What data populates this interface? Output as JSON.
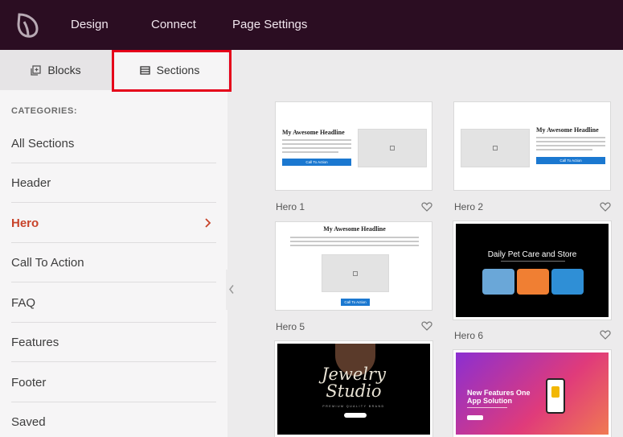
{
  "topbar": {
    "nav": [
      "Design",
      "Connect",
      "Page Settings"
    ]
  },
  "tabs": {
    "blocks": "Blocks",
    "sections": "Sections"
  },
  "sidebar": {
    "categories_title": "CATEGORIES:",
    "categories": [
      "All Sections",
      "Header",
      "Hero",
      "Call To Action",
      "FAQ",
      "Features",
      "Footer",
      "Saved"
    ],
    "active": "Hero"
  },
  "sections": [
    {
      "label": "Hero 1",
      "headline": "My Awesome Headline",
      "button": "Call To Action"
    },
    {
      "label": "Hero 2",
      "headline": "My Awesome Headline",
      "button": "Call To Action"
    },
    {
      "label": "Hero 5",
      "headline": "My Awesome Headline",
      "button": "Call To Action"
    },
    {
      "label": "Hero 6",
      "headline": "Daily Pet Care and Store"
    },
    {
      "headline_line1": "Jewelry",
      "headline_line2": "Studio",
      "sub": "PREMIUM QUALITY BRAND"
    },
    {
      "headline_line1": "New Features One",
      "headline_line2": "App Solution"
    }
  ],
  "colors": {
    "topbar": "#2b0d22",
    "accent": "#c8432a",
    "highlight": "#e5001a",
    "cta_button": "#1b78d0"
  }
}
